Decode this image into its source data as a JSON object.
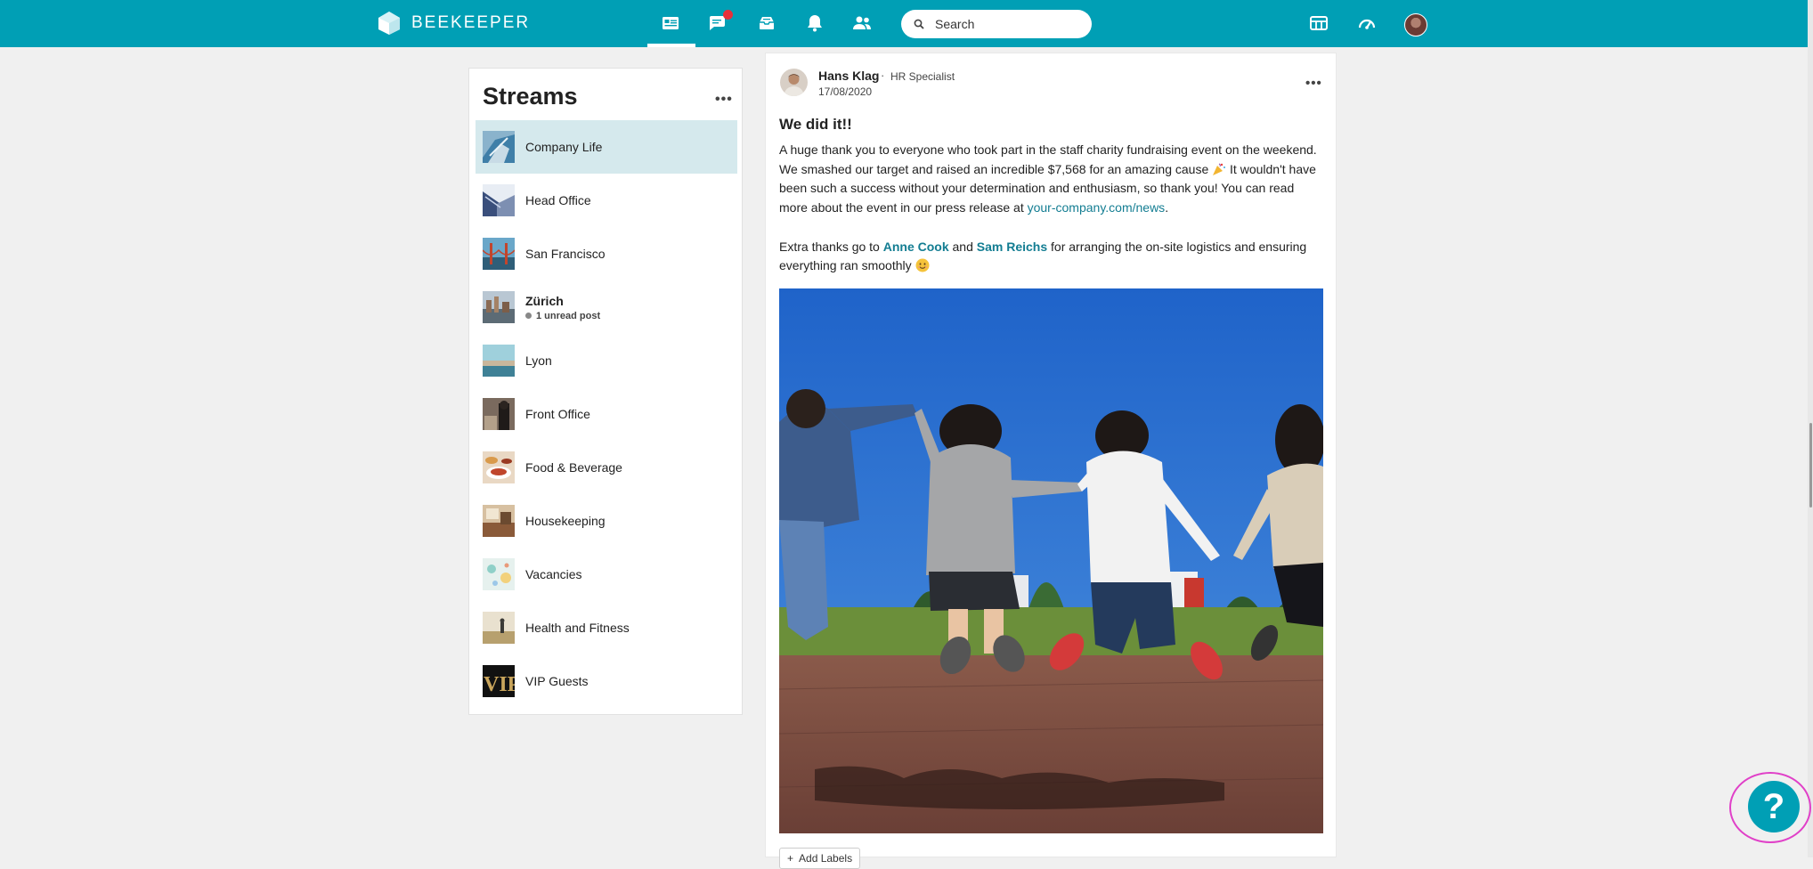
{
  "app": {
    "name": "BEEKEEPER"
  },
  "search": {
    "placeholder": "Search"
  },
  "nav": {
    "items": [
      "streams-icon",
      "chat-icon",
      "inbox-icon",
      "notifications-icon",
      "people-icon"
    ],
    "active": "streams-icon",
    "chat_has_unread": true
  },
  "header_right": [
    "apps-icon",
    "dashboard-icon",
    "avatar"
  ],
  "streams": {
    "title": "Streams",
    "items": [
      {
        "label": "Company Life",
        "active": true
      },
      {
        "label": "Head Office"
      },
      {
        "label": "San Francisco"
      },
      {
        "label": "Zürich",
        "sub": "1 unread post",
        "bold": true
      },
      {
        "label": "Lyon"
      },
      {
        "label": "Front Office"
      },
      {
        "label": "Food & Beverage"
      },
      {
        "label": "Housekeeping"
      },
      {
        "label": "Vacancies"
      },
      {
        "label": "Health and Fitness"
      },
      {
        "label": "VIP Guests"
      }
    ]
  },
  "post": {
    "author": "Hans Klag",
    "separator": "·",
    "role": "HR Specialist",
    "date": "17/08/2020",
    "title": "We did it!!",
    "p1_a": "A huge thank you to everyone who took part in the staff charity fundraising event on the weekend. We smashed our target and raised an incredible $7,568 for an amazing cause ",
    "p1_b": " It wouldn't have been such a success without your determination and enthusiasm, so thank you! You can read more about the event in our press release at ",
    "p1_link": "your-company.com/news",
    "p1_end": ".",
    "p2_a": "Extra thanks go to ",
    "p2_mention1": "Anne Cook",
    "p2_and": " and ",
    "p2_mention2": "Sam Reichs",
    "p2_b": " for arranging the on-site logistics and ensuring everything ran smoothly ",
    "add_labels": "Add Labels"
  },
  "help": {
    "label": "?"
  },
  "colors": {
    "brand": "#009fb5",
    "link": "#137d92",
    "active_row": "#d5e9ed"
  }
}
